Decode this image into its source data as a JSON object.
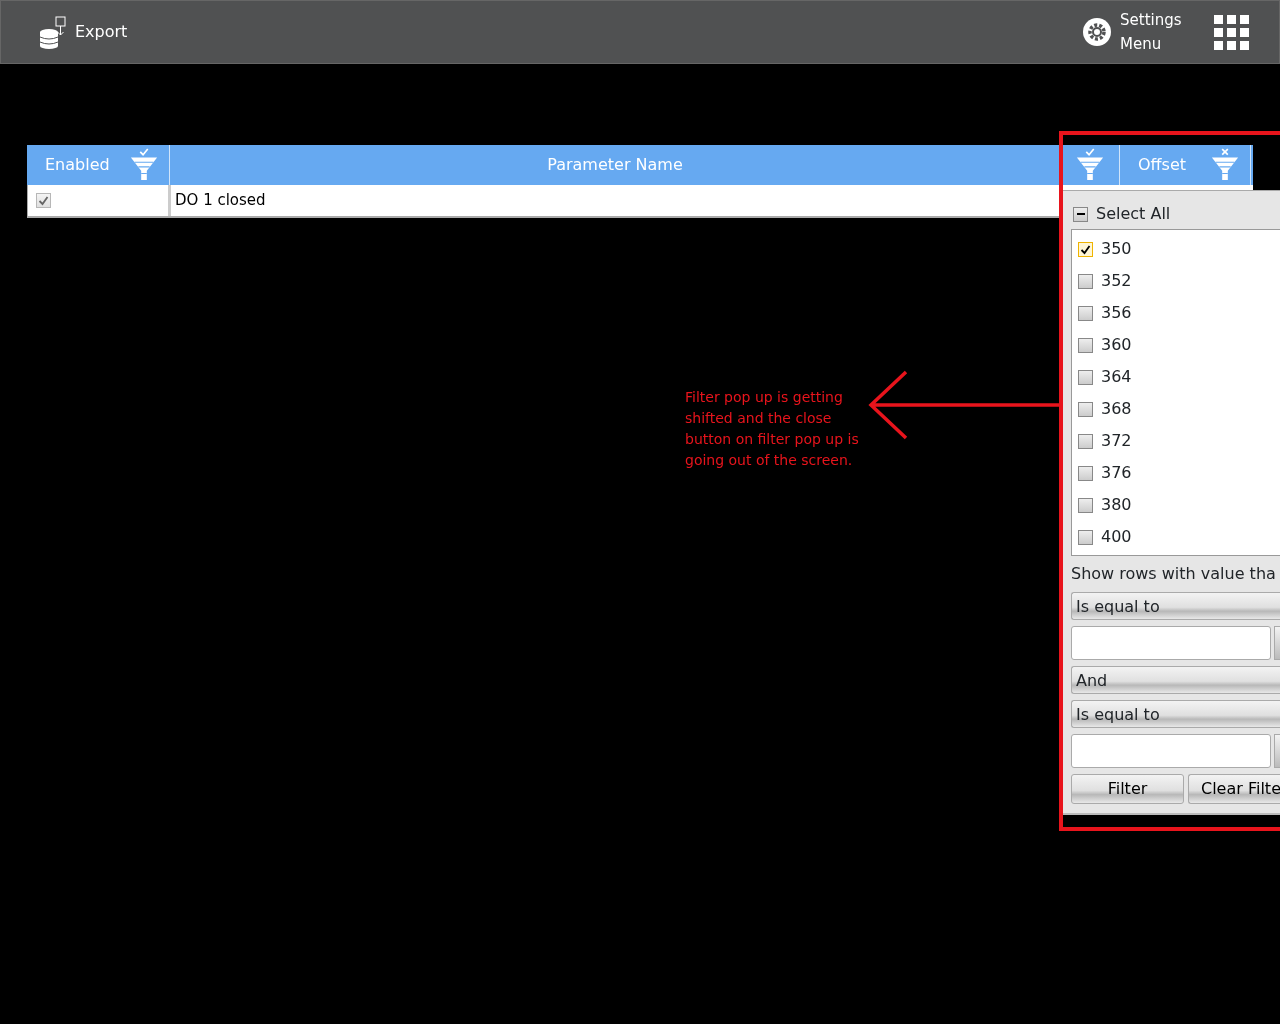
{
  "toolbar": {
    "export": {
      "label": "Export"
    },
    "settings": {
      "label": "Settings Menu"
    }
  },
  "table": {
    "columns": [
      {
        "label": "Enabled",
        "kind": "check"
      },
      {
        "label": "Parameter Name",
        "kind": "plain"
      },
      {
        "kind": "check"
      },
      {
        "label": "Offset",
        "kind": "clear"
      }
    ],
    "rows": [
      {
        "enabled": true,
        "parameter_name": "DO 1 closed"
      }
    ]
  },
  "filter_popup": {
    "select_all": {
      "label": "Select All",
      "indeterminate": true
    },
    "items": [
      {
        "label": "350",
        "checked": true
      },
      {
        "label": "352",
        "checked": false
      },
      {
        "label": "356",
        "checked": false
      },
      {
        "label": "360",
        "checked": false
      },
      {
        "label": "364",
        "checked": false
      },
      {
        "label": "368",
        "checked": false
      },
      {
        "label": "372",
        "checked": false
      },
      {
        "label": "376",
        "checked": false
      },
      {
        "label": "380",
        "checked": false
      },
      {
        "label": "400",
        "checked": false
      }
    ],
    "condition_label": "Show rows with value tha",
    "first_operator": "Is equal to",
    "logic": "And",
    "second_operator": "Is equal to",
    "buttons": [
      "Filter",
      "Clear Filte"
    ]
  },
  "annotation": {
    "text": "Filter pop up is getting shifted and the close button on filter pop up is going out of the screen."
  }
}
